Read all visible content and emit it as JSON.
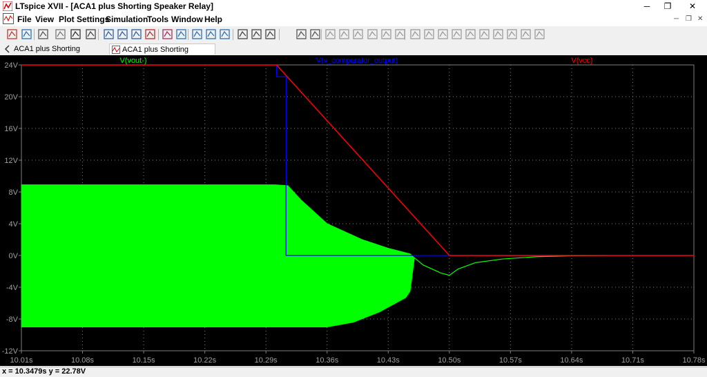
{
  "window": {
    "title": "LTspice XVII - [ACA1 plus Shorting Speaker Relay]",
    "minimize_glyph": "─",
    "maximize_glyph": "❐",
    "close_glyph": "✕"
  },
  "menu": {
    "items": [
      "File",
      "View",
      "Plot Settings",
      "Simulation",
      "Tools",
      "Window",
      "Help"
    ]
  },
  "toolbar": {
    "icons": [
      "schematic-icon",
      "open-icon",
      "save-icon",
      "control-panel-icon",
      "run-icon",
      "pan-hand-icon",
      "zoom-in-icon",
      "zoom-out-icon",
      "zoom-back-icon",
      "zoom-fit-icon",
      "autorange-icon",
      "grid-icon",
      "tile-horizontal-icon",
      "cascade-icon",
      "tile-vertical-icon",
      "cut-icon",
      "copy-icon",
      "find-icon",
      "print-icon",
      "print-setup-icon",
      "wire-icon",
      "ground-icon",
      "label-icon",
      "resistor-icon",
      "capacitor-icon",
      "inductor-icon",
      "diode-icon",
      "component-icon",
      "move-icon",
      "drag-icon",
      "undo-icon",
      "redo-icon",
      "rotate-icon",
      "mirror-icon",
      "text-icon",
      "spice-directive-icon"
    ]
  },
  "tabs": [
    {
      "label": "ACA1 plus Shorting Speaker Relay",
      "active": false
    },
    {
      "label": "ACA1 plus Shorting Speaker Relay",
      "active": true
    }
  ],
  "status": {
    "text": "x = 10.3479s   y = 22.78V"
  },
  "colors": {
    "plot_bg": "#000000",
    "grid": "#808080",
    "vout": "#00ff00",
    "comparator": "#0000ff",
    "vcc": "#ff0000"
  },
  "chart_data": {
    "type": "line",
    "xlabel": "",
    "ylabel": "",
    "xlim": [
      10.01,
      10.78
    ],
    "ylim": [
      -12,
      24
    ],
    "x_ticks": [
      "10.01s",
      "10.08s",
      "10.15s",
      "10.22s",
      "10.29s",
      "10.36s",
      "10.43s",
      "10.50s",
      "10.57s",
      "10.64s",
      "10.71s",
      "10.78s"
    ],
    "y_ticks": [
      "24V",
      "20V",
      "16V",
      "12V",
      "8V",
      "4V",
      "0V",
      "-4V",
      "-8V",
      "-12V"
    ],
    "grid": true,
    "series": [
      {
        "name": "V(vout-)",
        "color": "#00ff00",
        "style": "envelope",
        "upper": [
          [
            10.01,
            8.9
          ],
          [
            10.3,
            8.9
          ],
          [
            10.315,
            8.8
          ],
          [
            10.33,
            7.0
          ],
          [
            10.36,
            4.0
          ],
          [
            10.4,
            2.0
          ],
          [
            10.43,
            0.9
          ],
          [
            10.455,
            0.2
          ],
          [
            10.46,
            -0.3
          ]
        ],
        "lower": [
          [
            10.01,
            -9.0
          ],
          [
            10.36,
            -9.0
          ],
          [
            10.39,
            -8.4
          ],
          [
            10.42,
            -7.1
          ],
          [
            10.45,
            -5.3
          ],
          [
            10.455,
            -4.5
          ],
          [
            10.46,
            -0.3
          ]
        ],
        "tail": [
          [
            10.46,
            -0.3
          ],
          [
            10.47,
            -1.2
          ],
          [
            10.49,
            -2.2
          ],
          [
            10.5,
            -2.5
          ],
          [
            10.51,
            -1.7
          ],
          [
            10.53,
            -0.9
          ],
          [
            10.56,
            -0.45
          ],
          [
            10.6,
            -0.15
          ],
          [
            10.64,
            -0.05
          ],
          [
            10.68,
            0.0
          ]
        ]
      },
      {
        "name": "V(v_comparator_output)",
        "color": "#0000ff",
        "points": [
          [
            10.01,
            24.0
          ],
          [
            10.302,
            24.0
          ],
          [
            10.302,
            22.5
          ],
          [
            10.313,
            22.5
          ],
          [
            10.313,
            0.0
          ],
          [
            10.78,
            0.0
          ]
        ]
      },
      {
        "name": "V(vcc)",
        "color": "#ff0000",
        "points": [
          [
            10.01,
            24.0
          ],
          [
            10.302,
            24.0
          ],
          [
            10.5,
            0.0
          ],
          [
            10.78,
            0.0
          ]
        ]
      }
    ]
  }
}
